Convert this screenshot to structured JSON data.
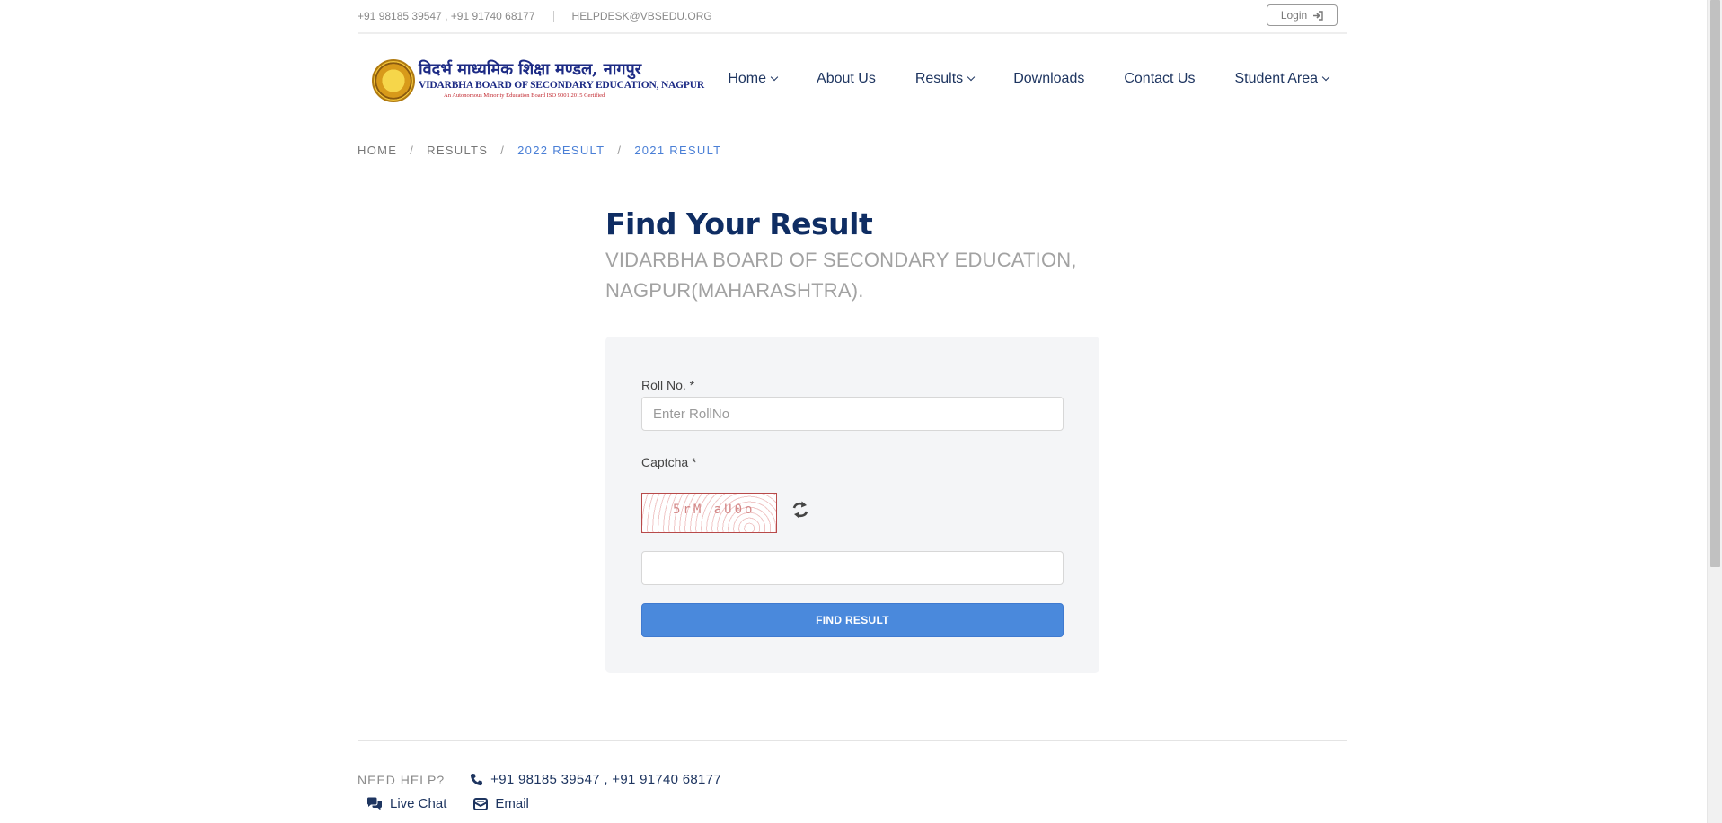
{
  "topbar": {
    "phones": "+91 98185 39547 , +91 91740 68177",
    "email": "HELPDESK@VBSEDU.ORG",
    "login_label": "Login"
  },
  "logo": {
    "hindi": "विदर्भ माध्यमिक शिक्षा मण्डल, नागपुर",
    "english": "VIDARBHA BOARD OF SECONDARY EDUCATION, NAGPUR",
    "sub": "An Autonomous Minority Education Board    ISO 9001:2015 Certified"
  },
  "nav": {
    "items": [
      {
        "label": "Home",
        "has_dropdown": true
      },
      {
        "label": "About Us",
        "has_dropdown": false
      },
      {
        "label": "Results",
        "has_dropdown": true
      },
      {
        "label": "Downloads",
        "has_dropdown": false
      },
      {
        "label": "Contact Us",
        "has_dropdown": false
      },
      {
        "label": "Student Area",
        "has_dropdown": true
      }
    ]
  },
  "breadcrumb": [
    "HOME",
    "RESULTS",
    "2022 RESULT",
    "2021 RESULT"
  ],
  "main": {
    "title": "Find Your Result",
    "subtitle_line1": "VIDARBHA BOARD OF SECONDARY EDUCATION,",
    "subtitle_line2": "NAGPUR(MAHARASHTRA)."
  },
  "form": {
    "roll_label": "Roll No. *",
    "roll_placeholder": "Enter RollNo",
    "roll_value": "",
    "captcha_label": "Captcha *",
    "captcha_text": "5rM aU0o",
    "captcha_value": "",
    "submit_label": "FIND RESULT"
  },
  "help": {
    "label": "NEED HELP?",
    "phones": "+91 98185 39547 , +91 91740 68177",
    "live_chat": "Live Chat",
    "email": "Email"
  },
  "colors": {
    "brand_navy": "#0f2d63",
    "link_blue": "#4a7fd6",
    "button_blue": "#4a89dc",
    "card_bg": "#f4f5f7"
  }
}
